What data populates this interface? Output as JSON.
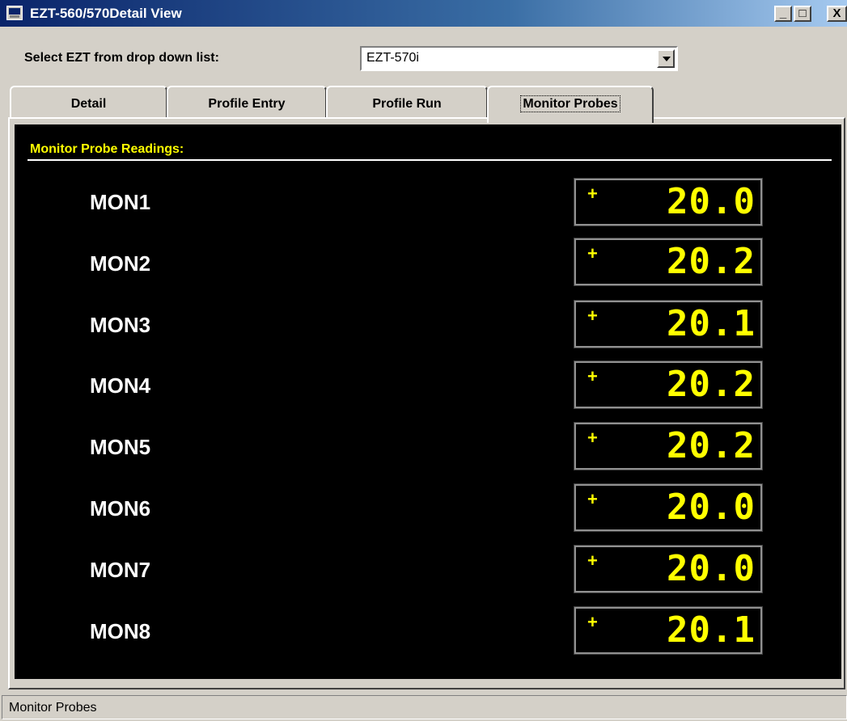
{
  "window": {
    "title": "EZT-560/570Detail View",
    "minimize": "_",
    "maximize": "□",
    "close": "X"
  },
  "selector": {
    "label": "Select EZT from drop down list:",
    "value": "EZT-570i"
  },
  "tabs": [
    {
      "label": "Detail",
      "active": false
    },
    {
      "label": "Profile Entry",
      "active": false
    },
    {
      "label": "Profile Run",
      "active": false
    },
    {
      "label": "Monitor Probes",
      "active": true
    }
  ],
  "panel": {
    "title": "Monitor Probe Readings:",
    "probes": [
      {
        "label": "MON1",
        "sign": "+",
        "value": "20.0"
      },
      {
        "label": "MON2",
        "sign": "+",
        "value": "20.2"
      },
      {
        "label": "MON3",
        "sign": "+",
        "value": "20.1"
      },
      {
        "label": "MON4",
        "sign": "+",
        "value": "20.2"
      },
      {
        "label": "MON5",
        "sign": "+",
        "value": "20.2"
      },
      {
        "label": "MON6",
        "sign": "+",
        "value": "20.0"
      },
      {
        "label": "MON7",
        "sign": "+",
        "value": "20.0"
      },
      {
        "label": "MON8",
        "sign": "+",
        "value": "20.1"
      }
    ]
  },
  "status_bar": {
    "text": "Monitor Probes"
  },
  "colors": {
    "lcd_digits": "#ffff00",
    "panel_bg": "#000000",
    "title_bar": "#0a246a"
  }
}
